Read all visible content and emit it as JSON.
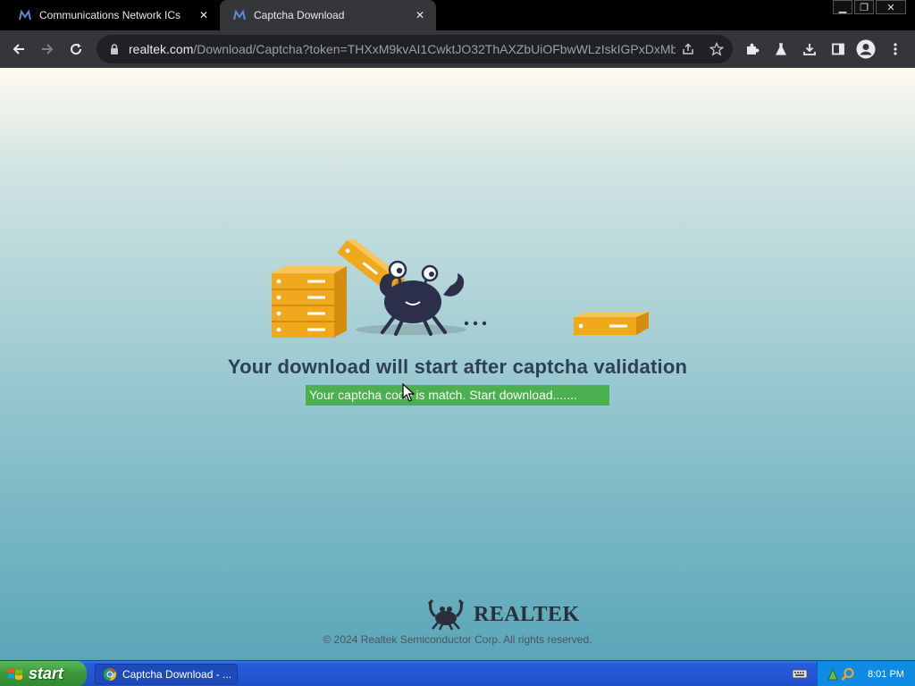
{
  "browser": {
    "tabs": [
      {
        "title": "Communications Network ICs",
        "active": false
      },
      {
        "title": "Captcha Download",
        "active": true
      }
    ],
    "url": {
      "host": "realtek.com",
      "path": "/Download/Captcha?token=THXxM9kvAI1CwktJO32ThAXZbUiOFbwWLzIskIGPxDxMb..."
    },
    "icons": {
      "back": "back-arrow-icon",
      "forward": "forward-arrow-icon",
      "reload": "reload-icon",
      "lock": "lock-icon",
      "share": "share-icon",
      "bookmark": "star-icon",
      "extensions": "puzzle-icon",
      "labs": "flask-icon",
      "downloads": "download-icon",
      "sidepanel": "side-panel-icon",
      "profile": "profile-icon",
      "menu": "kebab-menu-icon"
    }
  },
  "page": {
    "headline": "Your download will start after captcha validation",
    "status_message": "Your captcha code is match. Start download.......",
    "brand": "REALTEK",
    "copyright": "© 2024 Realtek Semiconductor Corp. All rights reserved.",
    "colors": {
      "status_bg": "#4caf50",
      "headline": "#2e4057",
      "box_orange": "#f0a91c"
    }
  },
  "taskbar": {
    "start_label": "start",
    "task_label": "Captcha Download - ...",
    "clock": "8:01 PM"
  }
}
